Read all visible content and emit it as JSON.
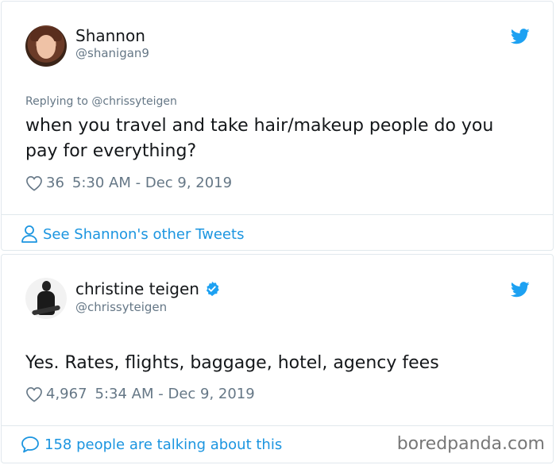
{
  "tweet1": {
    "name": "Shannon",
    "handle": "@shanigan9",
    "replying_to": "Replying to @chrissyteigen",
    "text": "when you travel and take hair/makeup people do you pay for everything?",
    "likes": "36",
    "timestamp": "5:30 AM - Dec 9, 2019",
    "footer_link": "See Shannon's other Tweets"
  },
  "tweet2": {
    "name": "christine teigen",
    "handle": "@chrissyteigen",
    "text": "Yes. Rates, flights, baggage, hotel, agency fees",
    "likes": "4,967",
    "timestamp": "5:34 AM - Dec 9, 2019",
    "footer_link": "158 people are talking about this"
  },
  "watermark": "boredpanda.com",
  "colors": {
    "twitter_blue": "#1da1f2",
    "link_blue": "#1b95e0",
    "muted_gray": "#657786",
    "text": "#14171a"
  },
  "icons": [
    "twitter-bird-icon",
    "heart-icon",
    "person-icon",
    "speech-bubble-icon",
    "verified-badge-icon"
  ]
}
